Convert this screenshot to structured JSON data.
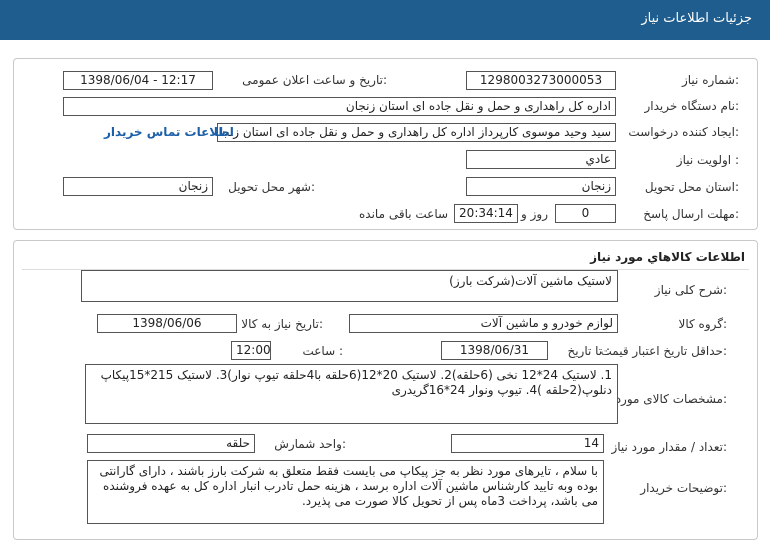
{
  "window": {
    "title": "جزئيات اطلاعات نياز"
  },
  "info": {
    "need_number_label": "شماره نیاز:",
    "need_number": "1298003273000053",
    "announce_label": "تاریخ و ساعت اعلان عمومی:",
    "announce_value": "1398/06/04 - 12:17",
    "buyer_label": "نام دستگاه خریدار:",
    "buyer_value": "اداره کل راهداری و حمل و نقل جاده ای استان زنجان",
    "creator_label": "ایجاد کننده درخواست:",
    "creator_value": "سید وحید موسوی کارپرداز اداره کل راهداری و حمل و نقل جاده ای استان زنجان",
    "contact_link": "اطلاعات تماس خریدار",
    "priority_label": "اولویت نیاز :",
    "priority_value": "عادي",
    "province_label": "استان محل تحویل:",
    "province_value": "زنجان",
    "city_label": "شهر محل تحویل:",
    "city_value": "زنجان",
    "deadline_label": "مهلت ارسال پاسخ:",
    "days_value": "0",
    "days_label": "روز و",
    "time_value": "20:34:14",
    "remaining_label": "ساعت باقی مانده"
  },
  "goods": {
    "section_title": "اطلاعات کالاهاي مورد نياز",
    "summary_label": "شرح کلی نیاز:",
    "summary_value": "لاستیک ماشین آلات(شرکت بارز)",
    "group_label": "گروه کالا:",
    "group_value": "لوازم خودرو و ماشین آلات",
    "need_date_label": "تاریخ نیاز به کالا:",
    "need_date_value": "1398/06/06",
    "validity_label": "حداقل تاریخ اعتبار قیمت:",
    "until_label": "تا تاریخ :",
    "validity_date": "1398/06/31",
    "hour_label": "ساعت :",
    "hour_value": "12:00",
    "specs_label": "مشخصات کالای مورد نیاز:",
    "specs_value": "1. لاستیک 24*12 نخی (6حلقه)2. لاستیک 20*12(6حلقه با4حلقه تیوپ نوار)3. لاستیک 215*15پیکاپ دنلوپ(2حلقه )4. تیوپ ونوار 24*16گریدری",
    "qty_label": "تعداد / مقدار مورد نیاز:",
    "qty_value": "14",
    "unit_label": "واحد شمارش:",
    "unit_value": "حلقه",
    "notes_label": "توضیحات خریدار:",
    "notes_value": "با سلام ، تایرهای مورد نظر به جز پیکاپ می بایست فقط متعلق به شرکت بارز باشند ، دارای گارانتی بوده وبه تایید کارشناس ماشین آلات اداره برسد ، هزینه حمل تادرب انبار اداره کل به عهده فروشنده می باشد، پرداخت 3ماه پس از تحویل کالا صورت می پذیرد."
  }
}
